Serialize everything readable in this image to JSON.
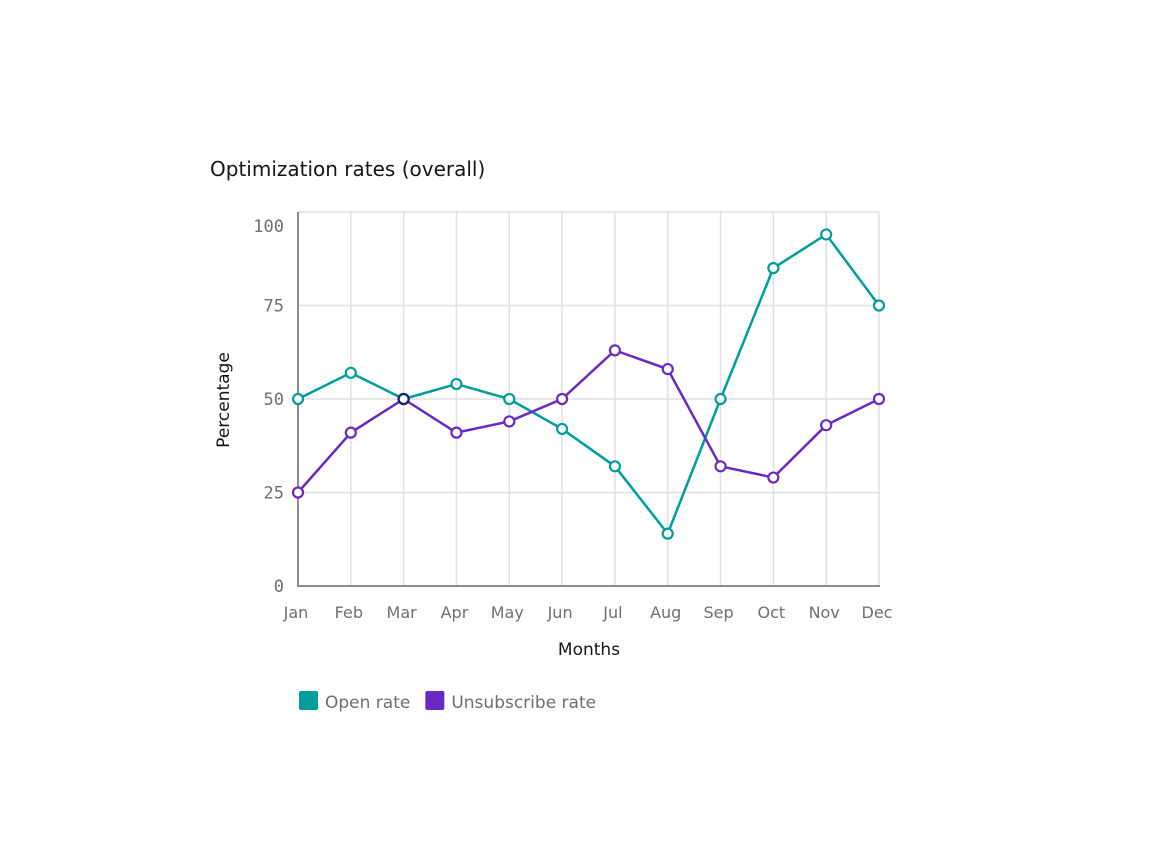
{
  "chart_data": {
    "type": "line",
    "title": "Optimization rates (overall)",
    "xlabel": "Months",
    "ylabel": "Percentage",
    "categories": [
      "Jan",
      "Feb",
      "Mar",
      "Apr",
      "May",
      "Jun",
      "Jul",
      "Aug",
      "Sep",
      "Oct",
      "Nov",
      "Dec"
    ],
    "yticks": [
      0,
      25,
      50,
      75,
      100
    ],
    "ylim": [
      0,
      100
    ],
    "grid": true,
    "legend_position": "bottom-left",
    "series": [
      {
        "name": "Open rate",
        "color": "#009d9a",
        "values": [
          50,
          57,
          50,
          54,
          50,
          42,
          32,
          14,
          50,
          85,
          94,
          75
        ]
      },
      {
        "name": "Unsubscribe rate",
        "color": "#6929c4",
        "values": [
          25,
          41,
          50,
          41,
          44,
          50,
          63,
          58,
          32,
          29,
          43,
          50
        ]
      }
    ],
    "overlap_marker_color": "#1c1f6b"
  }
}
